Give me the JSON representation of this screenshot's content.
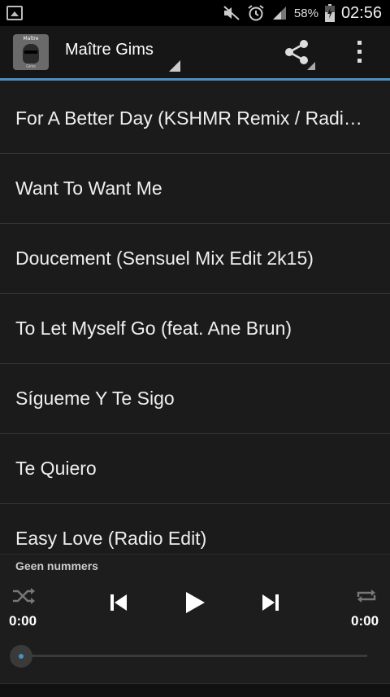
{
  "status_bar": {
    "battery_percent": "58%",
    "time": "02:56",
    "icons": [
      "gallery-icon",
      "mute-icon",
      "alarm-icon",
      "signal-icon",
      "battery-icon"
    ]
  },
  "action_bar": {
    "title": "Maître Gims",
    "album_art_text": "Maître",
    "album_art_subtext": "Gims",
    "icons": [
      "share-icon",
      "overflow-menu-icon"
    ],
    "accent_color": "#4a90c2"
  },
  "tracks": [
    "For A Better Day (KSHMR Remix / Radio Edit)",
    "Want To Want Me",
    "Doucement (Sensuel Mix Edit 2k15)",
    "To Let Myself Go (feat. Ane Brun)",
    "Sígueme Y Te Sigo",
    "Te Quiero",
    "Easy Love (Radio Edit)"
  ],
  "player": {
    "now_playing": "Geen nummers",
    "elapsed": "0:00",
    "total": "0:00",
    "progress": 0,
    "icons": [
      "shuffle-icon",
      "previous-icon",
      "play-icon",
      "next-icon",
      "repeat-icon"
    ]
  }
}
